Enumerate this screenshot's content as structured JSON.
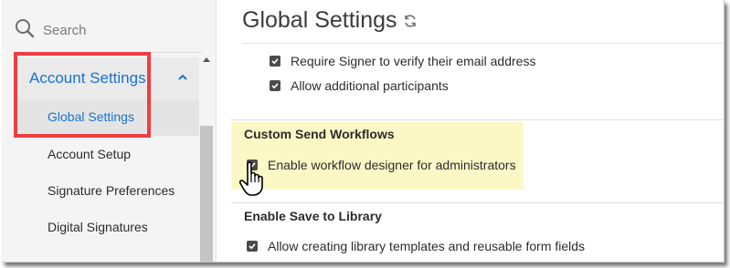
{
  "search": {
    "label": "Search"
  },
  "sidebar": {
    "account_settings": "Account Settings",
    "items": [
      {
        "label": "Global Settings"
      },
      {
        "label": "Account Setup"
      },
      {
        "label": "Signature Preferences"
      },
      {
        "label": "Digital Signatures"
      }
    ]
  },
  "main": {
    "title": "Global Settings",
    "options_top": [
      {
        "label": "Require Signer to verify their email address",
        "checked": true
      },
      {
        "label": "Allow additional participants",
        "checked": true
      }
    ],
    "custom_send": {
      "title": "Custom Send Workflows",
      "option": {
        "label": "Enable workflow designer for administrators",
        "checked": true
      }
    },
    "save_library": {
      "title": "Enable Save to Library",
      "option": {
        "label": "Allow creating library templates and reusable form fields",
        "checked": true
      }
    }
  },
  "colors": {
    "accent": "#1673d2",
    "callout_border": "#ee3d42",
    "highlight": "#fbf8c6",
    "sidebar_bg": "#f4f4f4"
  },
  "icons": [
    "search-icon",
    "chevron-up-icon",
    "refresh-icon",
    "checkbox-checked-icon",
    "hand-cursor-icon"
  ]
}
